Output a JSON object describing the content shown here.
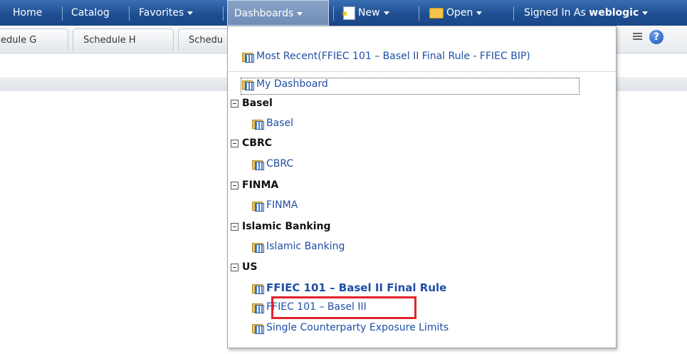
{
  "nav": {
    "home": "Home",
    "catalog": "Catalog",
    "favorites": "Favorites",
    "dashboards": "Dashboards",
    "new": "New",
    "open": "Open",
    "signed_in_as": "Signed In As",
    "user": "weblogic"
  },
  "tabs": [
    "edule G",
    "Schedule H",
    "Schedu"
  ],
  "menu": {
    "most_recent": "Most Recent(FFIEC 101 – Basel II Final Rule - FFIEC BIP)",
    "my_dashboard": "My Dashboard",
    "groups": [
      {
        "name": "Basel",
        "items": [
          "Basel"
        ]
      },
      {
        "name": "CBRC",
        "items": [
          "CBRC"
        ]
      },
      {
        "name": "FINMA",
        "items": [
          "FINMA"
        ]
      },
      {
        "name": "Islamic Banking",
        "items": [
          "Islamic Banking"
        ]
      },
      {
        "name": "US",
        "items": [
          "FFIEC 101 – Basel II Final Rule",
          "FFIEC 101 – Basel III",
          "Single Counterparty Exposure Limits"
        ]
      }
    ]
  },
  "help_label": "?",
  "colors": {
    "navbar": "#1e4f92",
    "link": "#1f4fa4",
    "highlight": "#e0242b"
  }
}
